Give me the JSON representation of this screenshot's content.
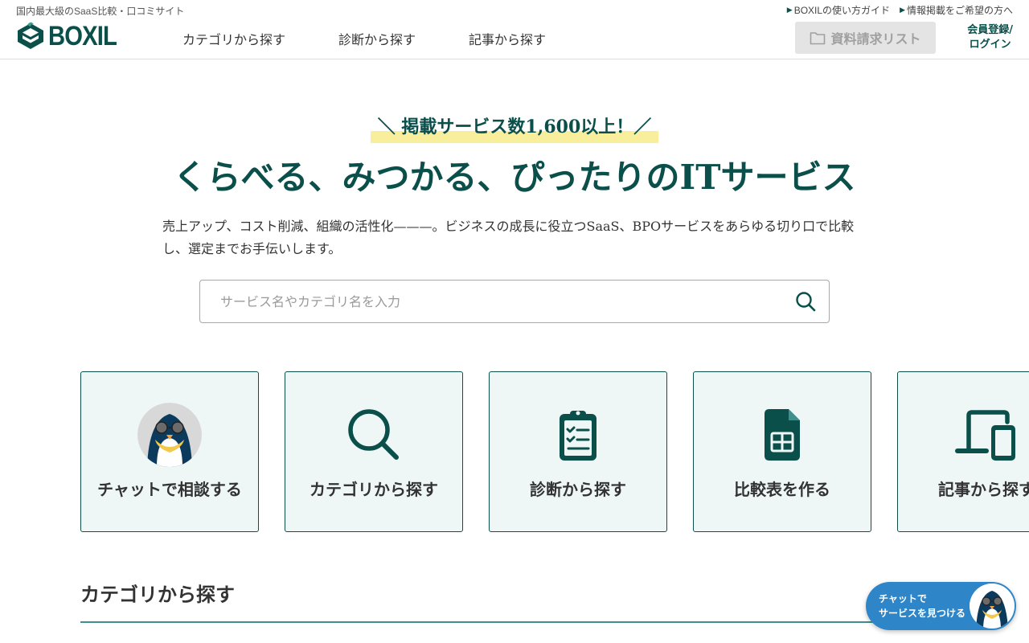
{
  "header": {
    "tagline": "国内最大級のSaaS比較・口コミサイト",
    "top_links": [
      {
        "label": "BOXILの使い方ガイド"
      },
      {
        "label": "情報掲載をご希望の方へ"
      }
    ],
    "logo_text": "BOXIL",
    "nav": [
      {
        "label": "カテゴリから探す"
      },
      {
        "label": "診断から探す"
      },
      {
        "label": "記事から探す"
      }
    ],
    "request_list_label": "資料請求リスト",
    "member_line1": "会員登録/",
    "member_line2": "ログイン"
  },
  "hero": {
    "badge": "＼ 掲載サービス数1,600以上！／",
    "title": "くらべる、みつかる、ぴったりのITサービス",
    "description": "売上アップ、コスト削減、組織の活性化———。ビジネスの成長に役立つSaaS、BPOサービスをあらゆる切り口で比較し、選定までお手伝いします。",
    "search_placeholder": "サービス名やカテゴリ名を入力"
  },
  "cards": [
    {
      "label": "チャットで相談する",
      "icon": "penguin-avatar-icon"
    },
    {
      "label": "カテゴリから探す",
      "icon": "search-icon"
    },
    {
      "label": "診断から探す",
      "icon": "clipboard-check-icon"
    },
    {
      "label": "比較表を作る",
      "icon": "spreadsheet-file-icon"
    },
    {
      "label": "記事から探す",
      "icon": "devices-icon"
    }
  ],
  "section": {
    "title": "カテゴリから探す"
  },
  "chat_fab": {
    "line1": "チャットで",
    "line2": "サービスを見つける"
  },
  "colors": {
    "brand": "#0a4f4a",
    "card_bg": "#eef6f6",
    "badge_highlight": "#f8ee9c",
    "chat_blue": "#2e86c9"
  }
}
